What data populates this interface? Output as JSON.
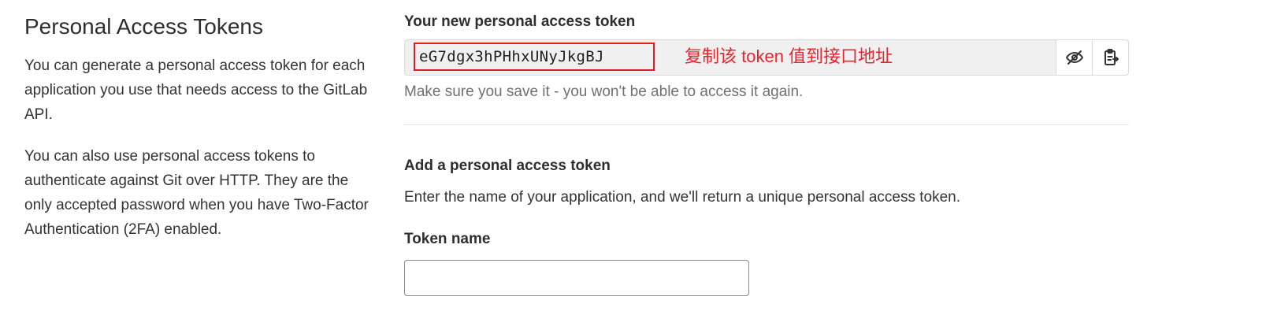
{
  "sidebar": {
    "title": "Personal Access Tokens",
    "description_1": "You can generate a personal access token for each application you use that needs access to the GitLab API.",
    "description_2": "You can also use personal access tokens to authenticate against Git over HTTP. They are the only accepted password when you have Two-Factor Authentication (2FA) enabled."
  },
  "new_token": {
    "label": "Your new personal access token",
    "value": "eG7dgx3hPHhxUNyJkgBJ",
    "annotation": "复制该 token 值到接口地址",
    "help": "Make sure you save it - you won't be able to access it again.",
    "toggle_icon": "eye-slash-icon",
    "copy_icon": "clipboard-copy-icon",
    "highlight_color": "#e02020"
  },
  "add_token": {
    "title": "Add a personal access token",
    "description": "Enter the name of your application, and we'll return a unique personal access token.",
    "name_label": "Token name",
    "name_value": "",
    "name_placeholder": ""
  }
}
